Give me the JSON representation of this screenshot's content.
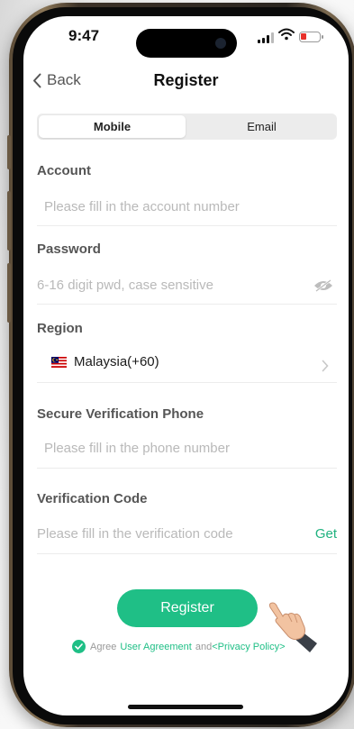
{
  "status_bar": {
    "time": "9:47"
  },
  "nav": {
    "back_label": "Back",
    "title": "Register"
  },
  "tabs": [
    {
      "label": "Mobile",
      "active": true
    },
    {
      "label": "Email",
      "active": false
    }
  ],
  "form": {
    "account": {
      "label": "Account",
      "placeholder": "Please fill in the account number",
      "value": ""
    },
    "password": {
      "label": "Password",
      "placeholder": "6-16 digit pwd, case sensitive",
      "value": "",
      "toggle_icon": "eye-hidden-icon"
    },
    "region": {
      "label": "Region",
      "value": "Malaysia(+60)",
      "flag_icon": "malaysia-flag-icon"
    },
    "phone": {
      "label": "Secure Verification Phone",
      "placeholder": "Please fill in the phone number",
      "value": ""
    },
    "code": {
      "label": "Verification Code",
      "placeholder": "Please fill in the verification code",
      "value": "",
      "get_label": "Get"
    }
  },
  "register_button": "Register",
  "agreement": {
    "checked": true,
    "prefix": "Agree",
    "user_agreement": "User Agreement",
    "and": "and",
    "privacy_policy": "<Privacy Policy>"
  },
  "colors": {
    "accent": "#1fbf86",
    "label": "#555555",
    "placeholder": "#b9b9b9"
  }
}
